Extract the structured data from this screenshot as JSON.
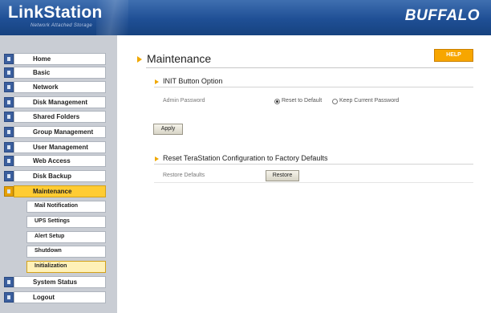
{
  "header": {
    "logo": "LinkStation",
    "logo_sub": "Network Attached Storage",
    "brand": "BUFFALO"
  },
  "sidebar": {
    "items": [
      {
        "label": "Home"
      },
      {
        "label": "Basic"
      },
      {
        "label": "Network"
      },
      {
        "label": "Disk Management"
      },
      {
        "label": "Shared Folders"
      },
      {
        "label": "Group Management"
      },
      {
        "label": "User Management"
      },
      {
        "label": "Web Access"
      },
      {
        "label": "Disk Backup"
      },
      {
        "label": "Maintenance"
      },
      {
        "label": "System Status"
      },
      {
        "label": "Logout"
      }
    ],
    "sub_items": [
      {
        "label": "Mail Notification"
      },
      {
        "label": "UPS Settings"
      },
      {
        "label": "Alert Setup"
      },
      {
        "label": "Shutdown"
      },
      {
        "label": "Initialization"
      }
    ],
    "active_item": "Maintenance",
    "selected_sub_item": "Initialization"
  },
  "main": {
    "title": "Maintenance",
    "help_label": "HELP",
    "init_section": {
      "title": "INIT Button Option",
      "row_label": "Admin Password",
      "options": [
        {
          "label": "Reset to Default",
          "checked": true
        },
        {
          "label": "Keep Current Password",
          "checked": false
        }
      ],
      "apply_label": "Apply"
    },
    "reset_section": {
      "title": "Reset TeraStation Configuration to Factory Defaults",
      "row_label": "Restore Defaults",
      "restore_label": "Restore"
    }
  },
  "colors": {
    "header_blue": "#1f4f95",
    "sidebar_bg": "#c9cdd4",
    "active_yellow": "#ffcc33",
    "help_orange": "#f7a600",
    "arrow_orange": "#f0a800"
  }
}
